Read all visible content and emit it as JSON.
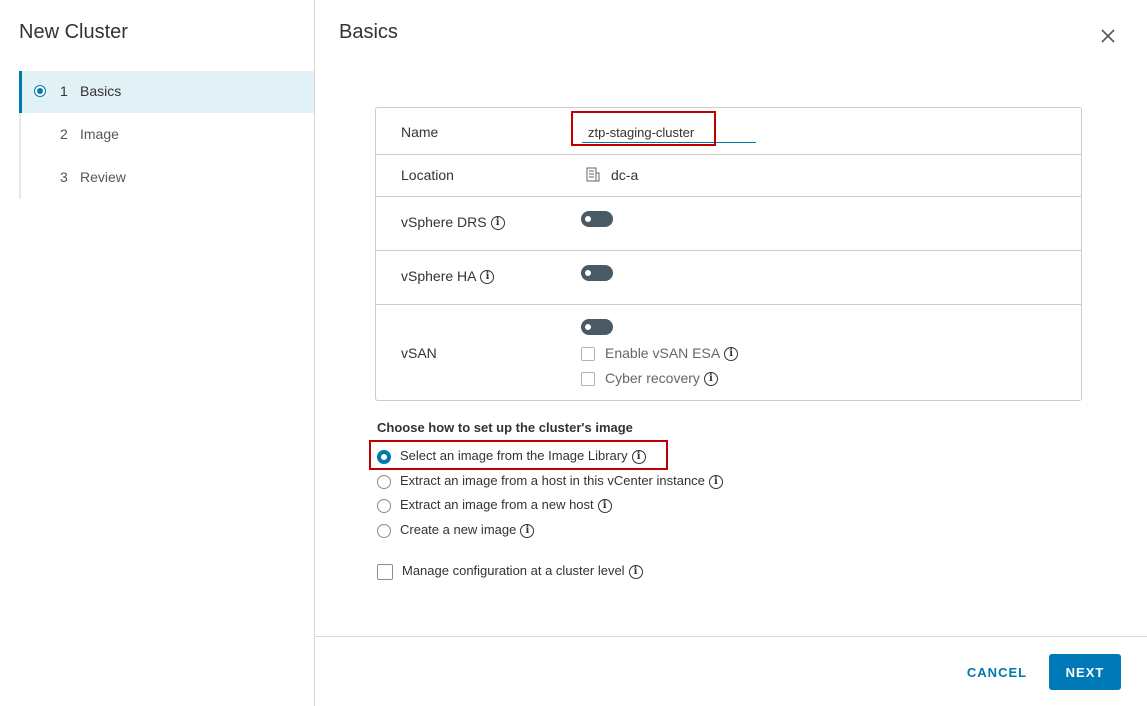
{
  "wizard": {
    "title": "New Cluster",
    "steps": [
      {
        "number": "1",
        "label": "Basics",
        "active": true
      },
      {
        "number": "2",
        "label": "Image",
        "active": false
      },
      {
        "number": "3",
        "label": "Review",
        "active": false
      }
    ]
  },
  "content": {
    "title": "Basics",
    "close_icon": "close-icon"
  },
  "form": {
    "name": {
      "label": "Name",
      "value": "ztp-staging-cluster"
    },
    "location": {
      "label": "Location",
      "value": "dc-a",
      "icon": "datacenter-icon"
    },
    "drs": {
      "label": "vSphere DRS",
      "enabled": false
    },
    "ha": {
      "label": "vSphere HA",
      "enabled": false
    },
    "vsan": {
      "label": "vSAN",
      "enabled": false,
      "esa_label": "Enable vSAN ESA",
      "cyber_label": "Cyber recovery"
    }
  },
  "image_setup": {
    "title": "Choose how to set up the cluster's image",
    "options": [
      {
        "label": "Select an image from the Image Library",
        "selected": true
      },
      {
        "label": "Extract an image from a host in this vCenter instance",
        "selected": false
      },
      {
        "label": "Extract an image from a new host",
        "selected": false
      },
      {
        "label": "Create a new image",
        "selected": false
      }
    ],
    "manage_config_label": "Manage configuration at a cluster level"
  },
  "footer": {
    "cancel_label": "CANCEL",
    "next_label": "NEXT"
  },
  "colors": {
    "accent": "#0079ad",
    "highlight": "#c00000",
    "active_step_bg": "#e1f1f6",
    "toggle_off": "#4a5a64"
  }
}
